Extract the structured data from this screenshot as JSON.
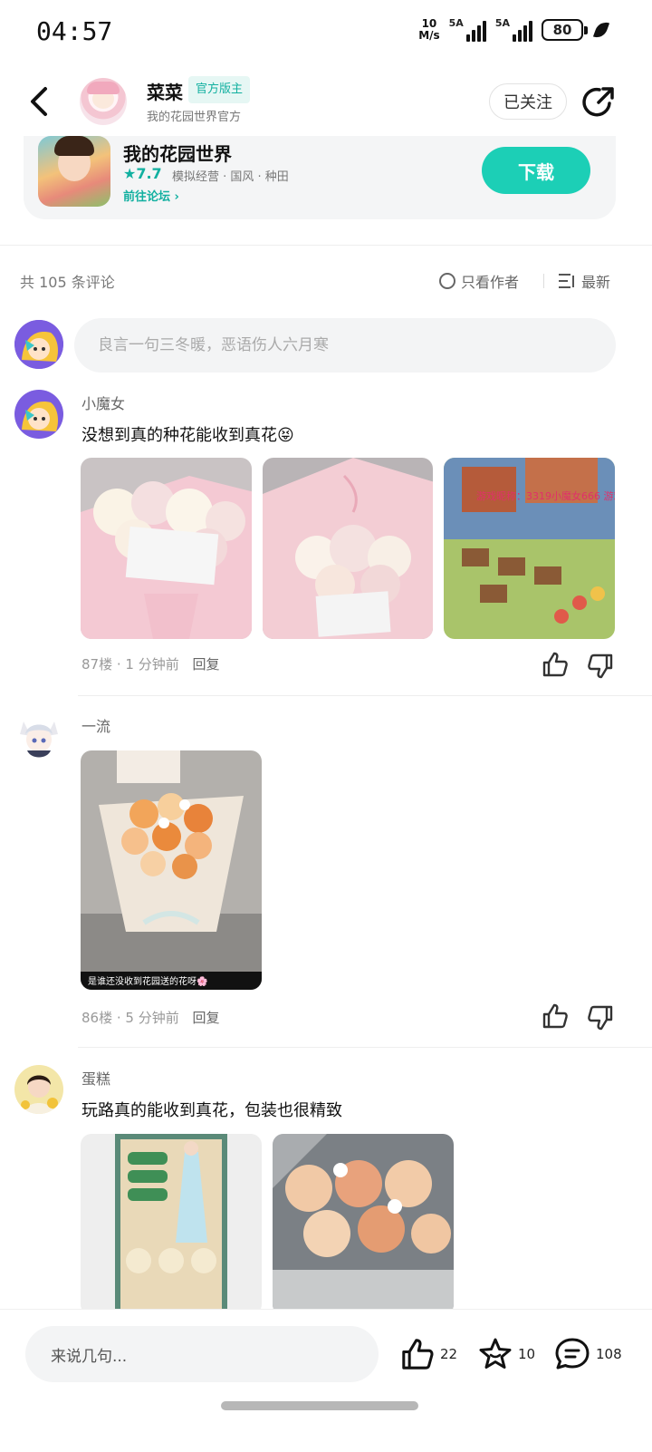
{
  "status_bar": {
    "time": "04:57",
    "net_speed_value": "10",
    "net_speed_unit": "M/s",
    "signal1_label": "5A",
    "signal2_label": "5A",
    "battery": "80"
  },
  "header": {
    "name": "菜菜",
    "official_tag": "官方版主",
    "subtitle": "我的花园世界官方",
    "follow_label": "已关注"
  },
  "game_card": {
    "name": "我的花园世界",
    "rating": "★7.7",
    "tags": "模拟经营 · 国风 · 种田",
    "forum_link": "前往论坛",
    "download_label": "下载"
  },
  "comments_header": {
    "count": "共 105 条评论",
    "author_only": "只看作者",
    "sort": "最新"
  },
  "composer": {
    "placeholder": "良言一句三冬暖，恶语伤人六月寒"
  },
  "comments": [
    {
      "user": "小魔女",
      "text": "没想到真的种花能收到真花😝",
      "meta": "87楼 · 1 分钟前",
      "reply": "回复",
      "image3_overlay": "游戏昵称：3319小魔女666 游戏ID：y5Op..."
    },
    {
      "user": "一流",
      "text": "",
      "meta": "86楼 · 5 分钟前",
      "reply": "回复",
      "image_caption": "是谁还没收到花园送的花呀🌸"
    },
    {
      "user": "蛋糕",
      "text": "玩路真的能收到真花，包装也很精致",
      "meta": "",
      "reply": ""
    }
  ],
  "bottom_bar": {
    "input_label": "来说几句...",
    "like_count": "22",
    "fav_count": "10",
    "comment_count": "108"
  },
  "colors": {
    "accent": "#1ccfb6",
    "accent_text": "#12b0a0",
    "background": "#ffffff",
    "muted": "#999999"
  }
}
